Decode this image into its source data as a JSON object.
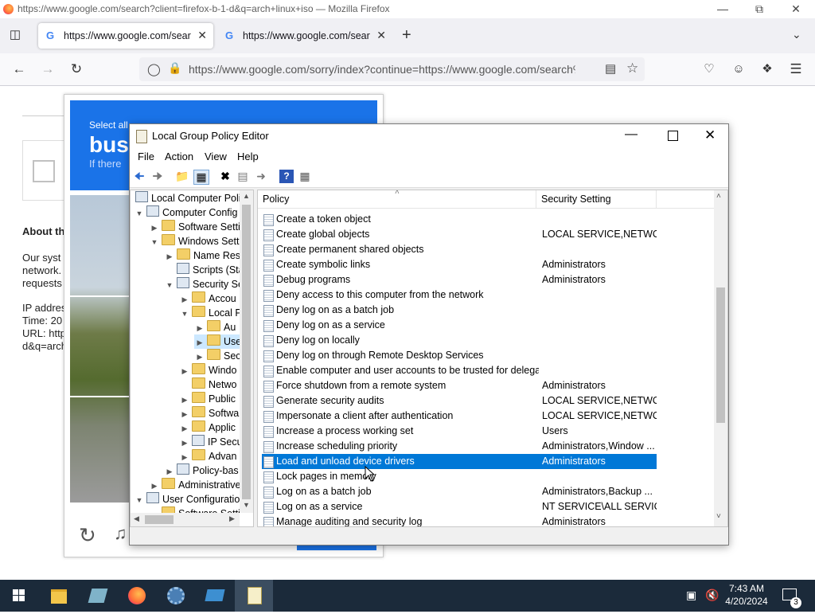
{
  "firefox": {
    "window_title": "https://www.google.com/search?client=firefox-b-1-d&q=arch+linux+iso — Mozilla Firefox",
    "tabs": [
      {
        "label": "https://www.google.com/search"
      },
      {
        "label": "https://www.google.com/search"
      }
    ],
    "url": "https://www.google.com/sorry/index?continue=https://www.google.com/search%3Fc"
  },
  "google_page": {
    "about_heading": "About th",
    "para_lines": [
      "Our syst",
      "network.",
      "requests"
    ],
    "info_lines": [
      "IP addres",
      "Time: 20",
      "URL: http",
      "d&q=arch"
    ],
    "captcha": {
      "select_all": "Select all",
      "big_word": "bus",
      "if_there": "If there"
    }
  },
  "gpe": {
    "title": "Local Group Policy Editor",
    "menu": [
      "File",
      "Action",
      "View",
      "Help"
    ],
    "tree": [
      "Local Computer Polic",
      "Computer Config",
      "Software Setti",
      "Windows Sett",
      "Name Res",
      "Scripts (Sta",
      "Security Se",
      "Accou",
      "Local P",
      "Au",
      "Use",
      "Sec",
      "Windo",
      "Netwo",
      "Public",
      "Softwa",
      "Applic",
      "IP Secu",
      "Advan",
      "Policy-bas",
      "Administrative",
      "User Configuratio",
      "Software Setti"
    ],
    "columns": {
      "policy": "Policy",
      "setting": "Security Setting"
    },
    "rows": [
      {
        "policy": "Create a token object",
        "setting": ""
      },
      {
        "policy": "Create global objects",
        "setting": "LOCAL SERVICE,NETWO..."
      },
      {
        "policy": "Create permanent shared objects",
        "setting": ""
      },
      {
        "policy": "Create symbolic links",
        "setting": "Administrators"
      },
      {
        "policy": "Debug programs",
        "setting": "Administrators"
      },
      {
        "policy": "Deny access to this computer from the network",
        "setting": ""
      },
      {
        "policy": "Deny log on as a batch job",
        "setting": ""
      },
      {
        "policy": "Deny log on as a service",
        "setting": ""
      },
      {
        "policy": "Deny log on locally",
        "setting": ""
      },
      {
        "policy": "Deny log on through Remote Desktop Services",
        "setting": ""
      },
      {
        "policy": "Enable computer and user accounts to be trusted for delega...",
        "setting": ""
      },
      {
        "policy": "Force shutdown from a remote system",
        "setting": "Administrators"
      },
      {
        "policy": "Generate security audits",
        "setting": "LOCAL SERVICE,NETWO..."
      },
      {
        "policy": "Impersonate a client after authentication",
        "setting": "LOCAL SERVICE,NETWO..."
      },
      {
        "policy": "Increase a process working set",
        "setting": "Users"
      },
      {
        "policy": "Increase scheduling priority",
        "setting": "Administrators,Window ..."
      },
      {
        "policy": "Load and unload device drivers",
        "setting": "Administrators"
      },
      {
        "policy": "Lock pages in memory",
        "setting": ""
      },
      {
        "policy": "Log on as a batch job",
        "setting": "Administrators,Backup ..."
      },
      {
        "policy": "Log on as a service",
        "setting": "NT SERVICE\\ALL SERVICES"
      },
      {
        "policy": "Manage auditing and security log",
        "setting": "Administrators"
      }
    ],
    "selected_row": "Load and unload device drivers"
  },
  "taskbar": {
    "time": "7:43 AM",
    "date": "4/20/2024",
    "notification_count": "3"
  },
  "colors": {
    "selection": "#0078d7",
    "taskbar": "#1b2a3a",
    "captcha_blue": "#1a73e8"
  }
}
